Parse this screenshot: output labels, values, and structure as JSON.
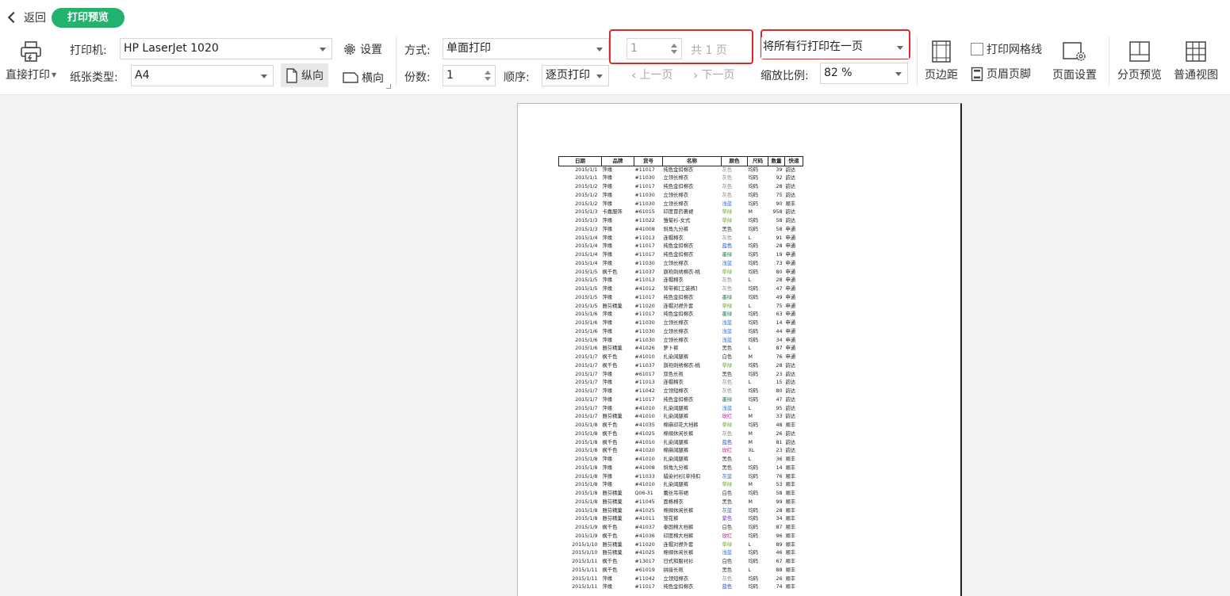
{
  "header": {
    "back_label": "返回",
    "title": "打印预览"
  },
  "printer": {
    "direct_print_label": "直接打印",
    "printer_label": "打印机:",
    "printer_value": "HP LaserJet 1020",
    "settings_label": "设置",
    "paper_type_label": "纸张类型:",
    "paper_value": "A4",
    "portrait_label": "纵向",
    "landscape_label": "横向"
  },
  "mode": {
    "method_label": "方式:",
    "method_value": "单面打印",
    "copies_label": "份数:",
    "copies_value": "1",
    "order_label": "顺序:",
    "order_value": "逐页打印"
  },
  "pages": {
    "current": "1",
    "total_label": "共 1 页",
    "prev_label": "上一页",
    "next_label": "下一页"
  },
  "scale": {
    "fit_value": "将所有行打印在一页",
    "zoom_label": "缩放比例:",
    "zoom_value": "82 %"
  },
  "layout": {
    "margins_label": "页边距",
    "gridlines_label": "打印网格线",
    "header_footer_label": "页眉页脚",
    "page_setup_label": "页面设置",
    "page_break_label": "分页预览",
    "normal_view_label": "普通视图"
  },
  "colors": {
    "accent": "#21b26e",
    "highlight": "#e3262a"
  },
  "sheet": {
    "headers": [
      "日期",
      "品牌",
      "货号",
      "名称",
      "颜色",
      "尺码",
      "数量",
      "快递"
    ],
    "rows": [
      [
        "2015/1/1",
        "萍缘",
        "#11017",
        "纯色金扣棉衣",
        "灰色",
        "均码",
        "39",
        "韵达",
        "#888"
      ],
      [
        "2015/1/1",
        "萍缘",
        "#11030",
        "立领长棉衣",
        "灰色",
        "均码",
        "92",
        "韵达",
        "#888"
      ],
      [
        "2015/1/2",
        "萍缘",
        "#11017",
        "纯色金扣棉衣",
        "灰色",
        "均码",
        "28",
        "韵达",
        "#888"
      ],
      [
        "2015/1/2",
        "萍缘",
        "#11030",
        "立领长棉衣",
        "灰色",
        "均码",
        "75",
        "韵达",
        "#888"
      ],
      [
        "2015/1/2",
        "萍缘",
        "#11030",
        "立领长棉衣",
        "浅蓝",
        "均码",
        "90",
        "顺丰",
        "#2c6fd6"
      ],
      [
        "2015/1/3",
        "卡嘉服饰",
        "#61015",
        "印度冒药裹裙",
        "草绿",
        "M",
        "958",
        "韵达",
        "#6aaa20"
      ],
      [
        "2015/1/3",
        "萍缘",
        "#11022",
        "雏菊衫-女式",
        "草绿",
        "均码",
        "58",
        "韵达",
        "#6aaa20"
      ],
      [
        "2015/1/3",
        "萍缘",
        "#41008",
        "斜角九分裤",
        "黑色",
        "均码",
        "58",
        "申通",
        "#333"
      ],
      [
        "2015/1/4",
        "萍缘",
        "#11013",
        "连帽棉衣",
        "灰色",
        "L",
        "91",
        "申通",
        "#888"
      ],
      [
        "2015/1/4",
        "萍缘",
        "#11017",
        "纯色金扣棉衣",
        "蓝色",
        "均码",
        "28",
        "申通",
        "#1a4ccf"
      ],
      [
        "2015/1/4",
        "萍缘",
        "#11017",
        "纯色金扣棉衣",
        "墨绿",
        "均码",
        "19",
        "申通",
        "#1a7a50"
      ],
      [
        "2015/1/4",
        "萍缘",
        "#11030",
        "立领长棉衣",
        "浅蓝",
        "均码",
        "73",
        "申通",
        "#2c6fd6"
      ],
      [
        "2015/1/5",
        "枫千色",
        "#11037",
        "旗袍刺绣棉衣-桃",
        "草绿",
        "均码",
        "80",
        "申通",
        "#6aaa20"
      ],
      [
        "2015/1/5",
        "萍缘",
        "#11013",
        "连帽棉衣",
        "灰色",
        "L",
        "28",
        "申通",
        "#888"
      ],
      [
        "2015/1/5",
        "萍缘",
        "#41012",
        "背带裤[工装裤]",
        "灰色",
        "均码",
        "47",
        "申通",
        "#888"
      ],
      [
        "2015/1/5",
        "萍缘",
        "#11017",
        "纯色金扣棉衣",
        "墨绿",
        "均码",
        "49",
        "申通",
        "#1a7a50"
      ],
      [
        "2015/1/5",
        "雅芬精菓",
        "#11020",
        "连帽对襟外套",
        "草绿",
        "L",
        "75",
        "申通",
        "#6aaa20"
      ],
      [
        "2015/1/6",
        "萍缘",
        "#11017",
        "纯色金扣棉衣",
        "墨绿",
        "均码",
        "63",
        "申通",
        "#1a7a50"
      ],
      [
        "2015/1/6",
        "萍缘",
        "#11030",
        "立领长棉衣",
        "浅蓝",
        "均码",
        "14",
        "申通",
        "#2c6fd6"
      ],
      [
        "2015/1/6",
        "萍缘",
        "#11030",
        "立领长棉衣",
        "浅蓝",
        "均码",
        "44",
        "申通",
        "#2c6fd6"
      ],
      [
        "2015/1/6",
        "萍缘",
        "#11030",
        "立领长棉衣",
        "浅蓝",
        "均码",
        "34",
        "申通",
        "#2c6fd6"
      ],
      [
        "2015/1/6",
        "雅芬精菓",
        "#41026",
        "萝卜裤",
        "黑色",
        "L",
        "87",
        "申通",
        "#333"
      ],
      [
        "2015/1/7",
        "枫千色",
        "#41010",
        "扎染阔腿裤",
        "白色",
        "M",
        "76",
        "申通",
        "#333"
      ],
      [
        "2015/1/7",
        "枫千色",
        "#11037",
        "旗袍刺绣棉衣-桃",
        "草绿",
        "均码",
        "28",
        "韵达",
        "#6aaa20"
      ],
      [
        "2015/1/7",
        "萍缘",
        "#61017",
        "双色长袍",
        "黑色",
        "均码",
        "23",
        "韵达",
        "#333"
      ],
      [
        "2015/1/7",
        "萍缘",
        "#11013",
        "连帽棉衣",
        "灰色",
        "L",
        "15",
        "韵达",
        "#888"
      ],
      [
        "2015/1/7",
        "萍缘",
        "#11042",
        "立领短棉衣",
        "灰色",
        "均码",
        "80",
        "韵达",
        "#888"
      ],
      [
        "2015/1/7",
        "萍缘",
        "#11017",
        "纯色金扣棉衣",
        "墨绿",
        "均码",
        "47",
        "韵达",
        "#1a7a50"
      ],
      [
        "2015/1/7",
        "萍缘",
        "#41010",
        "扎染阔腿裤",
        "浅蓝",
        "L",
        "95",
        "韵达",
        "#2c6fd6"
      ],
      [
        "2015/1/7",
        "雅芬精菓",
        "#41010",
        "扎染阔腿裤",
        "玫红",
        "M",
        "33",
        "韵达",
        "#d21a9a"
      ],
      [
        "2015/1/8",
        "枫千色",
        "#41035",
        "棉麻印花大裆裤",
        "草绿",
        "均码",
        "48",
        "顺丰",
        "#6aaa20"
      ],
      [
        "2015/1/8",
        "枫千色",
        "#41025",
        "棉绸休闲长裤",
        "灰色",
        "M",
        "26",
        "韵达",
        "#888"
      ],
      [
        "2015/1/8",
        "枫千色",
        "#41010",
        "扎染阔腿裤",
        "蓝色",
        "M",
        "81",
        "韵达",
        "#1a4ccf"
      ],
      [
        "2015/1/8",
        "枫千色",
        "#41020",
        "棉麻阔腿裤",
        "玫红",
        "XL",
        "23",
        "韵达",
        "#d21a9a"
      ],
      [
        "2015/1/8",
        "萍缘",
        "#41010",
        "扎染阔腿裤",
        "黑色",
        "L",
        "36",
        "顺丰",
        "#333"
      ],
      [
        "2015/1/8",
        "萍缘",
        "#41008",
        "斜角九分裤",
        "黑色",
        "均码",
        "14",
        "顺丰",
        "#333"
      ],
      [
        "2015/1/8",
        "萍缘",
        "#11033",
        "蜡染衬衫[单排扣",
        "灰蓝",
        "均码",
        "76",
        "顺丰",
        "#3a6aa8"
      ],
      [
        "2015/1/8",
        "萍缘",
        "#41010",
        "扎染阔腿裤",
        "草绿",
        "M",
        "53",
        "顺丰",
        "#6aaa20"
      ],
      [
        "2015/1/8",
        "雅芬精菓",
        "Q06-31",
        "蕾丝吊带裙",
        "白色",
        "均码",
        "58",
        "顺丰",
        "#333"
      ],
      [
        "2015/1/8",
        "雅芬精菓",
        "#11045",
        "面格棉衣",
        "黑色",
        "M",
        "99",
        "顺丰",
        "#333"
      ],
      [
        "2015/1/8",
        "雅芬精菓",
        "#41025",
        "棉绸休闲长裤",
        "灰蓝",
        "均码",
        "28",
        "顺丰",
        "#3a6aa8"
      ],
      [
        "2015/1/8",
        "雅芬精菓",
        "#41011",
        "笼花裤",
        "紫色",
        "均码",
        "34",
        "顺丰",
        "#8a2ac0"
      ],
      [
        "2015/1/9",
        "枫千色",
        "#41037",
        "泰国棉大裆裤",
        "白色",
        "均码",
        "87",
        "顺丰",
        "#333"
      ],
      [
        "2015/1/9",
        "枫千色",
        "#41036",
        "印度棉大裆裤",
        "玫红",
        "均码",
        "96",
        "顺丰",
        "#d21a9a"
      ],
      [
        "2015/1/10",
        "雅芬精菓",
        "#11020",
        "连帽对襟外套",
        "草绿",
        "L",
        "89",
        "顺丰",
        "#6aaa20"
      ],
      [
        "2015/1/10",
        "雅芬精菓",
        "#41025",
        "棉绸休闲长裤",
        "浅蓝",
        "均码",
        "46",
        "顺丰",
        "#2c6fd6"
      ],
      [
        "2015/1/11",
        "枫千色",
        "#13017",
        "日式和服衬衫",
        "白色",
        "均码",
        "67",
        "顺丰",
        "#333"
      ],
      [
        "2015/1/11",
        "枫千色",
        "#61019",
        "拼接长袍",
        "黑色",
        "L",
        "88",
        "顺丰",
        "#333"
      ],
      [
        "2015/1/11",
        "萍缘",
        "#11042",
        "立领短棉衣",
        "灰色",
        "均码",
        "26",
        "顺丰",
        "#888"
      ],
      [
        "2015/1/11",
        "萍缘",
        "#11017",
        "纯色金扣棉衣",
        "蓝色",
        "均码",
        "74",
        "顺丰",
        "#1a4ccf"
      ]
    ]
  }
}
